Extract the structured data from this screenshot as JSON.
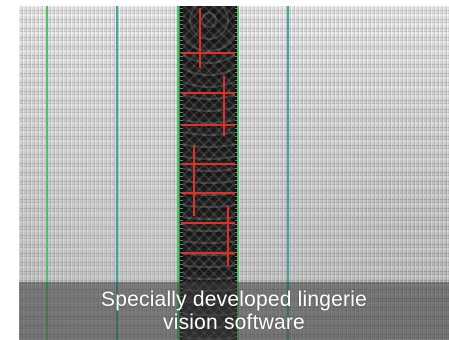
{
  "caption": {
    "line1": "Specially developed lingerie",
    "line2": "vision software"
  },
  "colors": {
    "guide_green": "#4fc06a",
    "guide_teal": "#3aa7a0",
    "mark_red": "#e0302a",
    "lace": "#1a1a1a"
  }
}
